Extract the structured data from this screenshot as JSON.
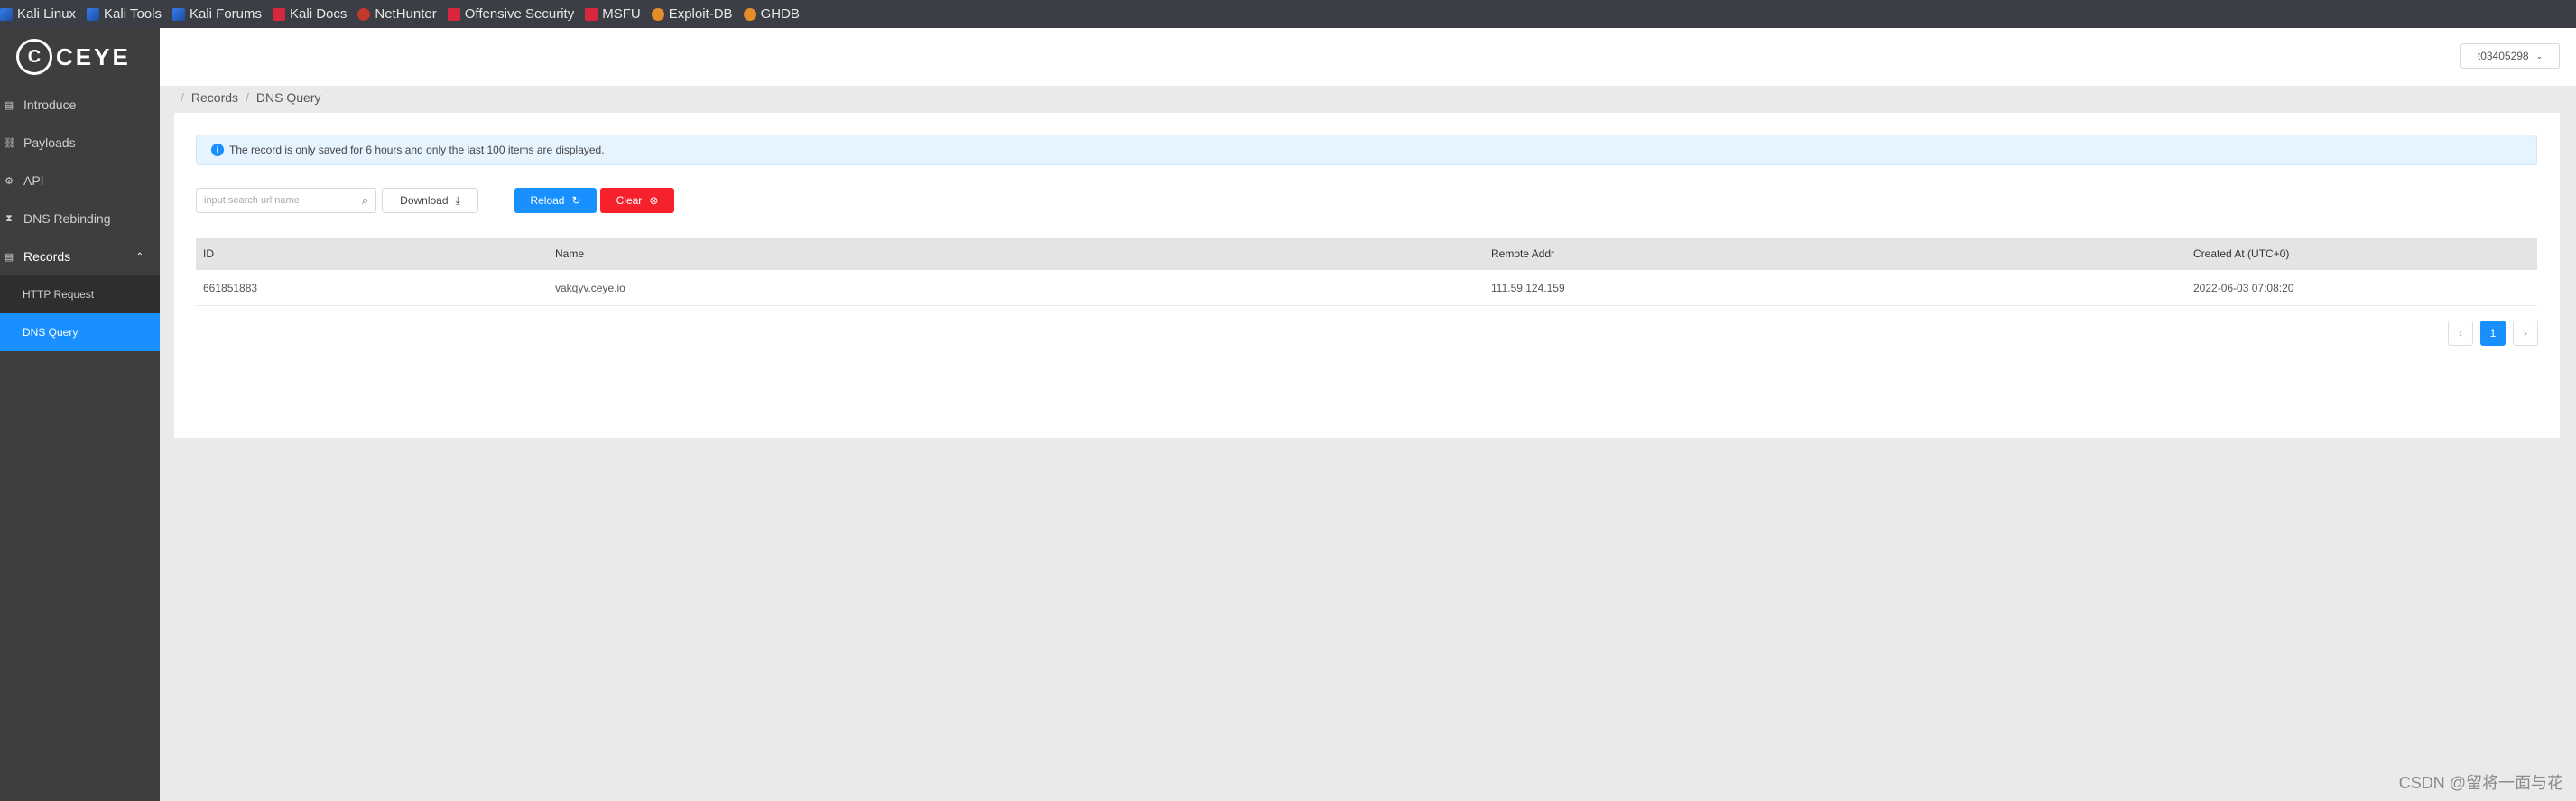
{
  "bookmarks": [
    {
      "label": "Kali Linux",
      "icon": "kali-icon"
    },
    {
      "label": "Kali Tools",
      "icon": "kali-icon"
    },
    {
      "label": "Kali Forums",
      "icon": "kali-icon"
    },
    {
      "label": "Kali Docs",
      "icon": "docs-icon"
    },
    {
      "label": "NetHunter",
      "icon": "nethunter-icon"
    },
    {
      "label": "Offensive Security",
      "icon": "offsec-icon"
    },
    {
      "label": "MSFU",
      "icon": "offsec-icon"
    },
    {
      "label": "Exploit-DB",
      "icon": "exploit-db-icon"
    },
    {
      "label": "GHDB",
      "icon": "exploit-db-icon"
    }
  ],
  "logo": {
    "text": "CEYE"
  },
  "sidebar": {
    "items": [
      {
        "label": "Introduce",
        "icon": "document-icon"
      },
      {
        "label": "Payloads",
        "icon": "link-icon"
      },
      {
        "label": "API",
        "icon": "api-icon"
      },
      {
        "label": "DNS Rebinding",
        "icon": "hourglass-icon"
      },
      {
        "label": "Records",
        "icon": "document-icon"
      }
    ],
    "sub_items": [
      {
        "label": "HTTP Request"
      },
      {
        "label": "DNS Query"
      }
    ]
  },
  "header": {
    "user": "t03405298"
  },
  "breadcrumb": [
    "Records",
    "DNS Query"
  ],
  "alert": {
    "text": "The record is only saved for 6 hours and only the last 100 items are displayed."
  },
  "toolbar": {
    "search_placeholder": "input search url name",
    "download_label": "Download",
    "reload_label": "Reload",
    "clear_label": "Clear"
  },
  "table": {
    "headers": [
      "ID",
      "Name",
      "Remote Addr",
      "Created At (UTC+0)"
    ],
    "rows": [
      [
        "661851883",
        "vakqyv.ceye.io",
        "111.59.124.159",
        "2022-06-03 07:08:20"
      ]
    ]
  },
  "pagination": {
    "current": "1",
    "prev": "‹",
    "next": "›"
  },
  "watermark": "CSDN @留将一面与花",
  "colors": {
    "primary": "#1890ff",
    "danger": "#f5222d",
    "sidebar": "#3e3e3e"
  }
}
